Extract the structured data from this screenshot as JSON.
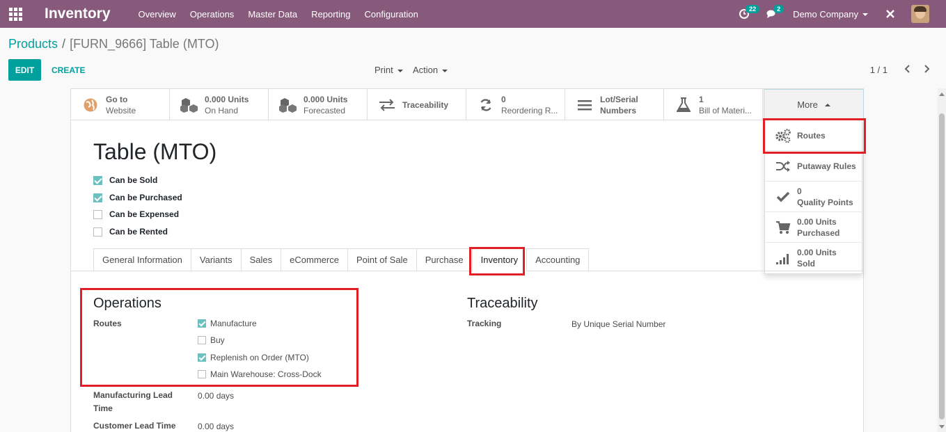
{
  "navbar": {
    "app_name": "Inventory",
    "menu": [
      "Overview",
      "Operations",
      "Master Data",
      "Reporting",
      "Configuration"
    ],
    "activity_badge": "22",
    "messages_badge": "2",
    "company": "Demo Company",
    "color": "#875a7b"
  },
  "breadcrumb": {
    "parent": "Products",
    "separator": "/",
    "current": "[FURN_9666] Table (MTO)"
  },
  "controls": {
    "edit": "EDIT",
    "create": "CREATE",
    "print": "Print",
    "action": "Action",
    "pager": "1 / 1"
  },
  "smart_buttons": [
    {
      "line1": "Go to",
      "line2": "Website",
      "icon": "globe-icon"
    },
    {
      "line1": "0.000 Units",
      "line2": "On Hand",
      "icon": "cubes-icon"
    },
    {
      "line1": "0.000 Units",
      "line2": "Forecasted",
      "icon": "cubes-icon"
    },
    {
      "line1": "Traceability",
      "line2": "",
      "icon": "exchange-icon"
    },
    {
      "line1": "0",
      "line2": "Reordering R...",
      "icon": "refresh-icon"
    },
    {
      "line1": "Lot/Serial",
      "line2": "Numbers",
      "icon": "list-icon"
    },
    {
      "line1": "1",
      "line2": "Bill of Materi...",
      "icon": "flask-icon"
    }
  ],
  "more": {
    "label": "More",
    "items": [
      {
        "line1": "Routes",
        "line2": "",
        "icon": "cogs-icon"
      },
      {
        "line1": "Putaway Rules",
        "line2": "",
        "icon": "random-icon"
      },
      {
        "line1": "0",
        "line2": "Quality Points",
        "icon": "check-icon"
      },
      {
        "line1": "0.00 Units",
        "line2": "Purchased",
        "icon": "cart-icon"
      },
      {
        "line1": "0.00 Units",
        "line2": "Sold",
        "icon": "signal-icon"
      }
    ]
  },
  "product": {
    "name": "Table (MTO)",
    "flags": [
      {
        "label": "Can be Sold",
        "checked": true
      },
      {
        "label": "Can be Purchased",
        "checked": true
      },
      {
        "label": "Can be Expensed",
        "checked": false
      },
      {
        "label": "Can be Rented",
        "checked": false
      }
    ]
  },
  "tabs": [
    "General Information",
    "Variants",
    "Sales",
    "eCommerce",
    "Point of Sale",
    "Purchase",
    "Inventory",
    "Accounting"
  ],
  "active_tab": "Inventory",
  "operations": {
    "title": "Operations",
    "routes_label": "Routes",
    "routes": [
      {
        "label": "Manufacture",
        "checked": true
      },
      {
        "label": "Buy",
        "checked": false
      },
      {
        "label": "Replenish on Order (MTO)",
        "checked": true
      },
      {
        "label": "Main Warehouse: Cross-Dock",
        "checked": false
      }
    ],
    "mfg_lead_label": "Manufacturing Lead Time",
    "mfg_lead_value": "0.00 days",
    "cust_lead_label": "Customer Lead Time",
    "cust_lead_value": "0.00 days"
  },
  "traceability": {
    "title": "Traceability",
    "tracking_label": "Tracking",
    "tracking_value": "By Unique Serial Number"
  },
  "colors": {
    "accent": "#00a09d",
    "highlight": "#e31f26",
    "checkbox": "#6cc1c0"
  }
}
